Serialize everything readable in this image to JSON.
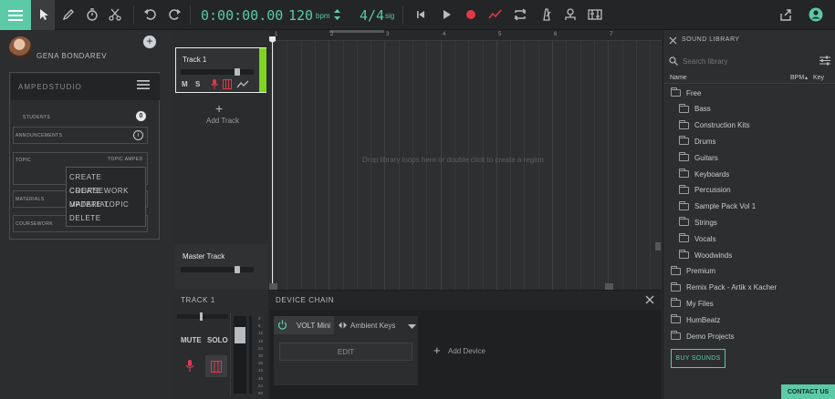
{
  "toolbar": {
    "time": "0:00:00.00",
    "bpm_value": "120",
    "bpm_unit": "bpm",
    "sig_value": "4/4",
    "sig_unit": "sig"
  },
  "sidebar": {
    "user_name": "GENA BONDAREV",
    "card_title": "AMPEDSTUDIO",
    "students_label": "STUDENTS",
    "students_count": "0",
    "announcements_label": "ANNOUNCEMENTS",
    "topic_label": "TOPIC",
    "topic_value": "TOPIC AMPED",
    "materials_label": "MATERIALS",
    "coursework_label": "COURSEWORK",
    "context_menu": [
      "CREATE COURSEWORK",
      "CREATE MATERIAL",
      "UPDATE TOPIC",
      "DELETE"
    ]
  },
  "tracks": {
    "track1_name": "Track 1",
    "mute_label": "M",
    "solo_label": "S",
    "add_track_label": "Add Track",
    "master_name": "Master Track",
    "track1_color": "#7ed321"
  },
  "arrangement": {
    "ruler": [
      "1",
      "2",
      "3",
      "4",
      "5",
      "6",
      "7"
    ],
    "empty_hint": "Drop library loops here or double click to create a region"
  },
  "bottom": {
    "track_title": "TRACK 1",
    "mute": "MUTE",
    "solo": "SOLO",
    "meter_labels": [
      "0",
      "6",
      "12",
      "18",
      "24",
      "30",
      "36",
      "42",
      "48",
      "54",
      "60"
    ],
    "device_chain_title": "DEVICE CHAIN",
    "device_name": "VOLT Mini",
    "preset_name": "Ambient Keys",
    "edit_label": "EDIT",
    "add_device_label": "Add Device"
  },
  "library": {
    "title": "SOUND LIBRARY",
    "search_placeholder": "Search library",
    "col_name": "Name",
    "col_bpm": "BPM",
    "col_key": "Key",
    "items": [
      {
        "label": "Free",
        "indent": 0
      },
      {
        "label": "Bass",
        "indent": 1
      },
      {
        "label": "Construction Kits",
        "indent": 1
      },
      {
        "label": "Drums",
        "indent": 1
      },
      {
        "label": "Guitars",
        "indent": 1
      },
      {
        "label": "Keyboards",
        "indent": 1
      },
      {
        "label": "Percussion",
        "indent": 1
      },
      {
        "label": "Sample Pack Vol 1",
        "indent": 1
      },
      {
        "label": "Strings",
        "indent": 1
      },
      {
        "label": "Vocals",
        "indent": 1
      },
      {
        "label": "Woodwinds",
        "indent": 1
      },
      {
        "label": "Premium",
        "indent": 0
      },
      {
        "label": "Remix Pack - Artik x Kacher",
        "indent": 0
      },
      {
        "label": "My Files",
        "indent": 0
      },
      {
        "label": "HumBeatz",
        "indent": 0
      },
      {
        "label": "Demo Projects",
        "indent": 0
      }
    ],
    "buy_label": "BUY SOUNDS"
  },
  "contact_label": "CONTACT US",
  "colors": {
    "accent": "#5cc9a7",
    "record": "#e0394a",
    "track_green": "#7ed321"
  }
}
